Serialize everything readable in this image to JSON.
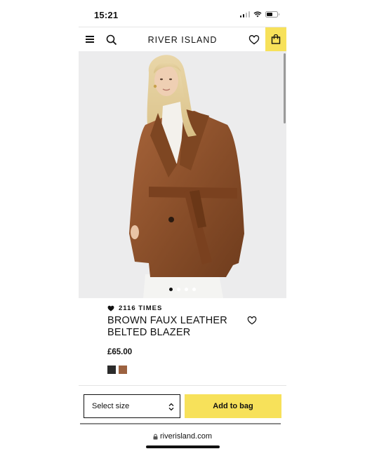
{
  "status_bar": {
    "time": "15:21"
  },
  "header": {
    "brand": "RIVER ISLAND"
  },
  "product": {
    "likes_count": "2116 TIMES",
    "title_line1": "BROWN FAUX LEATHER",
    "title_line2": "BELTED BLAZER",
    "price": "£65.00",
    "swatches": [
      {
        "name": "black",
        "color": "#2b2b2b"
      },
      {
        "name": "brown",
        "color": "#9c6240"
      }
    ],
    "carousel_total": 4,
    "carousel_active": 1
  },
  "actions": {
    "size_placeholder": "Select size",
    "add_to_bag": "Add to bag"
  },
  "browser": {
    "url": "riverisland.com"
  },
  "colors": {
    "accent": "#f7e15a"
  }
}
